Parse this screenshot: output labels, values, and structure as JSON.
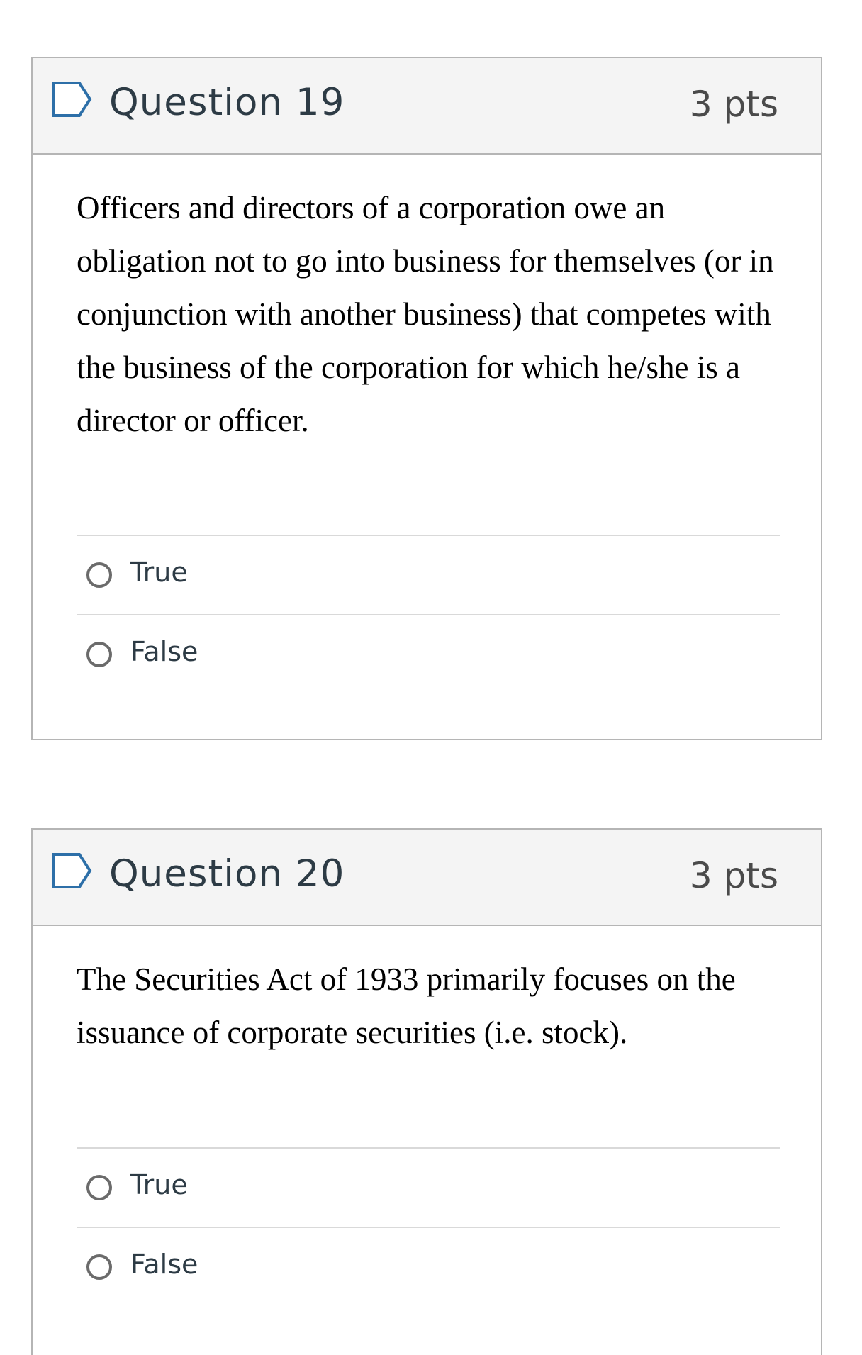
{
  "questions": [
    {
      "title": "Question 19",
      "points": "3 pts",
      "text": "Officers and directors of a corporation owe an obligation not to go into business for themselves (or in conjunction with another business) that competes with the business of the corporation for which he/she is a director or officer.",
      "answers": [
        "True",
        "False"
      ]
    },
    {
      "title": "Question 20",
      "points": "3 pts",
      "text": "The Securities Act of 1933 primarily focuses on the issuance of corporate securities (i.e. stock).",
      "answers": [
        "True",
        "False"
      ]
    }
  ],
  "icons": {
    "flag": "flag-question-icon",
    "radio": "radio-unchecked-icon"
  },
  "colors": {
    "header_bg": "#f4f4f4",
    "border": "#b5b5b5",
    "divider": "#d9d9d9",
    "title_text": "#2d3b45",
    "points_text": "#4a4a4a",
    "radio": "#6b6b6b"
  }
}
